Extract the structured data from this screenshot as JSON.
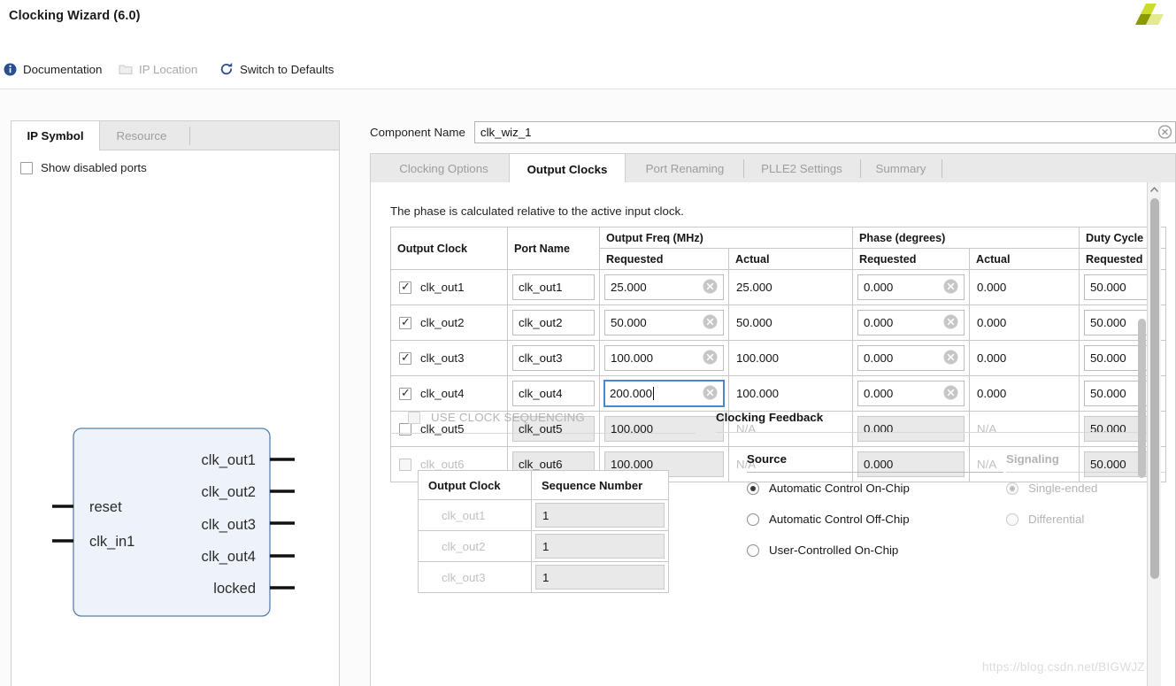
{
  "window": {
    "title": "Clocking Wizard (6.0)",
    "logo_name": "xilinx-logo"
  },
  "toolbar": {
    "documentation": "Documentation",
    "ip_location": "IP Location",
    "switch_defaults": "Switch to Defaults"
  },
  "left_panel": {
    "tabs": [
      {
        "label": "IP Symbol",
        "active": true
      },
      {
        "label": "Resource",
        "active": false
      }
    ],
    "show_disabled_ports": {
      "label": "Show disabled ports",
      "checked": false
    },
    "symbol": {
      "inputs": [
        "reset",
        "clk_in1"
      ],
      "outputs": [
        "clk_out1",
        "clk_out2",
        "clk_out3",
        "clk_out4",
        "locked"
      ],
      "fill": "#eef3fb",
      "stroke": "#5a7fae"
    }
  },
  "component": {
    "label": "Component Name",
    "value": "clk_wiz_1",
    "placeholder": ""
  },
  "main_tabs": [
    {
      "label": "Clocking Options",
      "active": false
    },
    {
      "label": "Output Clocks",
      "active": true
    },
    {
      "label": "Port Renaming",
      "active": false
    },
    {
      "label": "PLLE2 Settings",
      "active": false
    },
    {
      "label": "Summary",
      "active": false
    }
  ],
  "output_clocks": {
    "note": "The phase is calculated relative to the active input clock.",
    "headers": {
      "output_clock": "Output Clock",
      "port_name": "Port Name",
      "output_freq": "Output Freq (MHz)",
      "phase": "Phase (degrees)",
      "duty_cycle": "Duty Cycle",
      "requested": "Requested",
      "actual": "Actual"
    },
    "rows": [
      {
        "name": "clk_out1",
        "enabled": true,
        "row_disabled": false,
        "port_name": "clk_out1",
        "freq_requested": "25.000",
        "freq_actual": "25.000",
        "phase_requested": "0.000",
        "phase_actual": "0.000",
        "duty_requested": "50.000",
        "focused": false
      },
      {
        "name": "clk_out2",
        "enabled": true,
        "row_disabled": false,
        "port_name": "clk_out2",
        "freq_requested": "50.000",
        "freq_actual": "50.000",
        "phase_requested": "0.000",
        "phase_actual": "0.000",
        "duty_requested": "50.000",
        "focused": false
      },
      {
        "name": "clk_out3",
        "enabled": true,
        "row_disabled": false,
        "port_name": "clk_out3",
        "freq_requested": "100.000",
        "freq_actual": "100.000",
        "phase_requested": "0.000",
        "phase_actual": "0.000",
        "duty_requested": "50.000",
        "focused": false
      },
      {
        "name": "clk_out4",
        "enabled": true,
        "row_disabled": false,
        "port_name": "clk_out4",
        "freq_requested": "200.000",
        "freq_actual": "100.000",
        "phase_requested": "0.000",
        "phase_actual": "0.000",
        "duty_requested": "50.000",
        "focused": true
      },
      {
        "name": "clk_out5",
        "enabled": false,
        "row_disabled": false,
        "port_name": "clk_out5",
        "freq_requested": "100.000",
        "freq_actual": "N/A",
        "phase_requested": "0.000",
        "phase_actual": "N/A",
        "duty_requested": "50.000",
        "focused": false
      },
      {
        "name": "clk_out6",
        "enabled": false,
        "row_disabled": true,
        "port_name": "clk_out6",
        "freq_requested": "100.000",
        "freq_actual": "N/A",
        "phase_requested": "0.000",
        "phase_actual": "N/A",
        "duty_requested": "50.000",
        "focused": false
      }
    ]
  },
  "sequencing": {
    "use_clock_sequencing": "USE CLOCK SEQUENCING",
    "enabled": false,
    "headers": {
      "output_clock": "Output Clock",
      "sequence_number": "Sequence Number"
    },
    "rows": [
      {
        "name": "clk_out1",
        "seq": "1"
      },
      {
        "name": "clk_out2",
        "seq": "1"
      },
      {
        "name": "clk_out3",
        "seq": "1"
      }
    ]
  },
  "clocking_feedback": {
    "title": "Clocking Feedback",
    "source": {
      "label": "Source",
      "options": [
        {
          "label": "Automatic Control On-Chip",
          "selected": true
        },
        {
          "label": "Automatic Control Off-Chip",
          "selected": false
        },
        {
          "label": "User-Controlled On-Chip",
          "selected": false
        }
      ]
    },
    "signaling": {
      "label": "Signaling",
      "disabled": true,
      "options": [
        {
          "label": "Single-ended",
          "selected": true
        },
        {
          "label": "Differential",
          "selected": false
        }
      ]
    }
  },
  "watermark": "https://blog.csdn.net/BIGWJZ",
  "colors": {
    "accent": "#4a86d2",
    "header_text": "#1b1b1b",
    "disabled_text": "#bdbdbd",
    "panel_border": "#cfcfcf",
    "tab_inactive_bg": "#e9e9e9"
  }
}
